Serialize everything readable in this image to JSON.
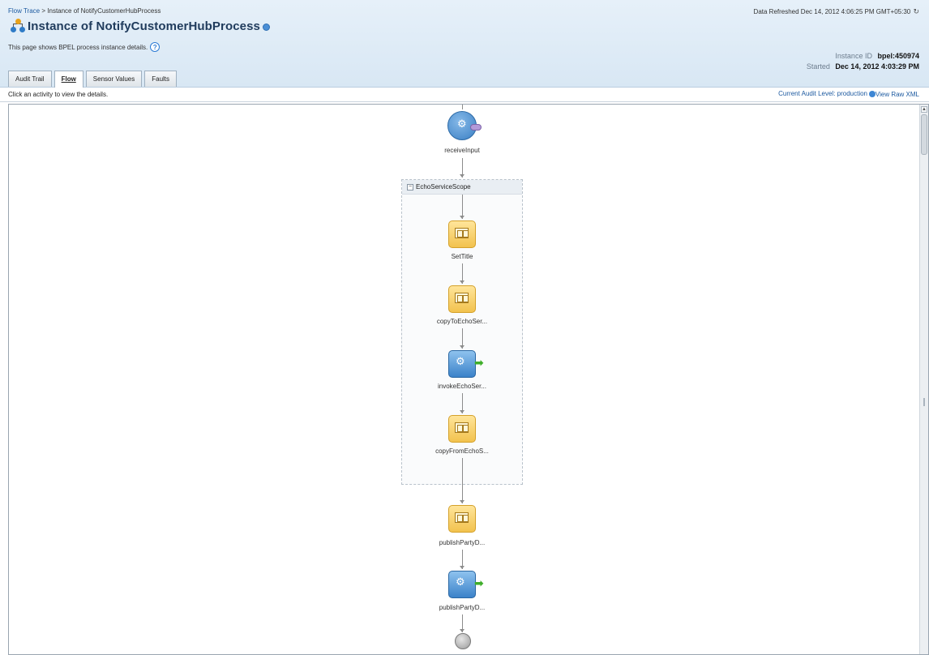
{
  "header": {
    "breadcrumb": {
      "parent": "Flow Trace",
      "separator": ">",
      "current": "Instance of NotifyCustomerHubProcess"
    },
    "refreshed": "Data Refreshed Dec 14, 2012 4:06:25 PM GMT+05:30",
    "title": "Instance of NotifyCustomerHubProcess",
    "subtitle": "This page shows BPEL process instance details.",
    "instance_id_label": "Instance ID",
    "instance_id": "bpel:450974",
    "started_label": "Started",
    "started": "Dec 14, 2012 4:03:29 PM"
  },
  "tabs": [
    {
      "label": "Audit Trail",
      "active": false
    },
    {
      "label": "Flow",
      "active": true
    },
    {
      "label": "Sensor Values",
      "active": false
    },
    {
      "label": "Faults",
      "active": false
    }
  ],
  "toolbar": {
    "hint": "Click an activity to view the details.",
    "audit_level": "Current Audit Level: production",
    "view_raw_xml": "View Raw XML"
  },
  "flow": {
    "scope_label": "EchoServiceScope",
    "nodes": [
      {
        "label": "receiveInput",
        "kind": "receive"
      },
      {
        "label": "SetTitle",
        "kind": "assign"
      },
      {
        "label": "copyToEchoSer...",
        "kind": "assign"
      },
      {
        "label": "invokeEchoSer...",
        "kind": "invoke"
      },
      {
        "label": "copyFromEchoS...",
        "kind": "assign"
      },
      {
        "label": "publishPartyD...",
        "kind": "assign"
      },
      {
        "label": "publishPartyD...",
        "kind": "invoke"
      }
    ]
  },
  "icons": {
    "process": "process-tree-icon",
    "help": "help-icon",
    "refresh": "refresh-icon",
    "info": "info-icon"
  },
  "colors": {
    "header_bg": "#dbe8f5",
    "link": "#1d5aa0",
    "assign_fill": "#f2c24e",
    "invoke_fill": "#3b82c9",
    "invoke_arrow": "#3fae2b"
  }
}
